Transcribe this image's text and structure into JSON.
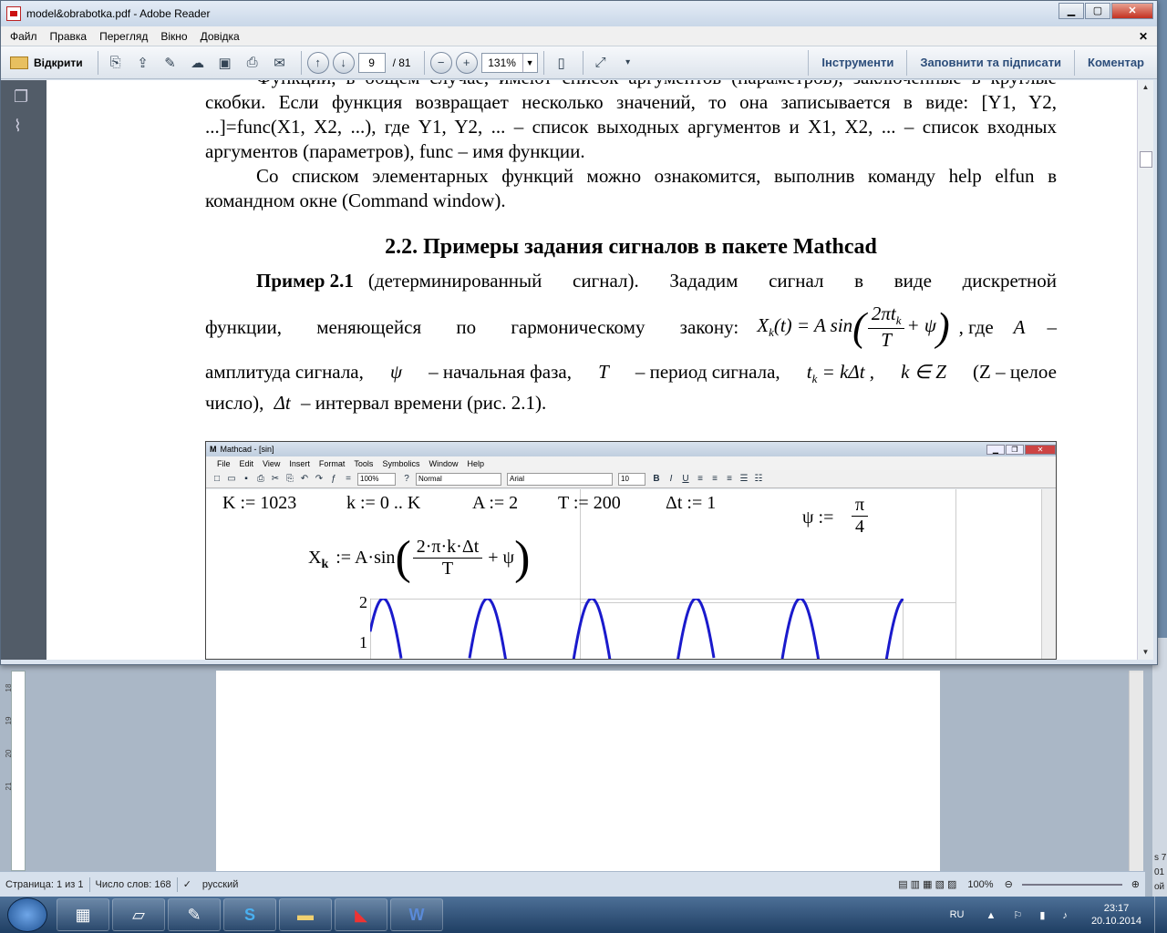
{
  "window": {
    "title": "model&obrabotka.pdf - Adobe Reader"
  },
  "menu": [
    "Файл",
    "Правка",
    "Перегляд",
    "Вікно",
    "Довідка"
  ],
  "toolbar": {
    "open_label": "Відкрити",
    "page_current": "9",
    "page_total": "/ 81",
    "zoom": "131%",
    "tools_label": "Інструменти",
    "fill_sign_label": "Заповнити та підписати",
    "comment_label": "Коментар"
  },
  "document": {
    "para1": "Функции, в общем случае, имеют список аргументов (параметров), заключенные в круглые скобки. Если функция возвращает несколько значений, то она записывается в виде: [Y1, Y2, ...]=func(X1, X2, ...), где Y1, Y2, ... – список выходных аргументов и X1, X2, ... – список входных аргументов (параметров), func – имя функции.",
    "para2": "Со списком элементарных функций можно ознакомится, выполнив команду help elfun в командном окне (Command window).",
    "heading": "2.2. Примеры задания сигналов в пакете Mathcad",
    "example_bold": "Пример 2.1",
    "example_text1": "(детерминированный сигнал). Зададим сигнал в виде дискретной",
    "example_text2": "функции, меняющейся по гармоническому закону:",
    "example_where": ", где",
    "example_A": "A",
    "example_dash": "–",
    "example_line3": "амплитуда сигнала,",
    "example_line3b": "– начальная фаза,",
    "example_line3c": "– период сигнала,",
    "example_line3d": "(Z – целое",
    "example_line4": "число),",
    "example_line4b": "– интервал времени (рис. 2.1)."
  },
  "mathcad": {
    "title": "Mathcad - [sin]",
    "menu": [
      "File",
      "Edit",
      "View",
      "Insert",
      "Format",
      "Tools",
      "Symbolics",
      "Window",
      "Help"
    ],
    "zoom": "100%",
    "style": "Normal",
    "font": "Arial",
    "size": "10",
    "defs": {
      "K": "K := 1023",
      "k": "k := 0 .. K",
      "A": "A := 2",
      "T": "T := 200",
      "dt": "Δt := 1",
      "psi_lhs": "ψ :=",
      "psi_num": "π",
      "psi_den": "4",
      "x_lhs": "X",
      "x_sub": "k",
      "x_mid": ":= A·sin",
      "x_num": "2·π·k·Δt",
      "x_den": "T",
      "x_plus": "+ ψ"
    },
    "plot_ticks": [
      "2",
      "1"
    ]
  },
  "chart_data": {
    "type": "line",
    "title": "",
    "xlabel": "",
    "ylabel": "",
    "ylim": [
      0.9,
      2.0
    ],
    "visible_ticks": [
      "2",
      "1"
    ],
    "series": [
      {
        "function": "2*sin(2*pi*k/200 + pi/4)"
      }
    ]
  },
  "word": {
    "status": {
      "page": "Страница: 1 из 1",
      "words": "Число слов: 168",
      "lang": "русский",
      "zoom": "100%"
    },
    "ruler": [
      "18",
      "19",
      "20",
      "21"
    ],
    "right_edge": [
      "s 7",
      "01",
      "ой"
    ]
  },
  "taskbar": {
    "lang": "RU",
    "time": "23:17",
    "date": "20.10.2014"
  },
  "colors": {
    "plot_line": "#1a1acc",
    "accent": "#2c4d7a"
  }
}
